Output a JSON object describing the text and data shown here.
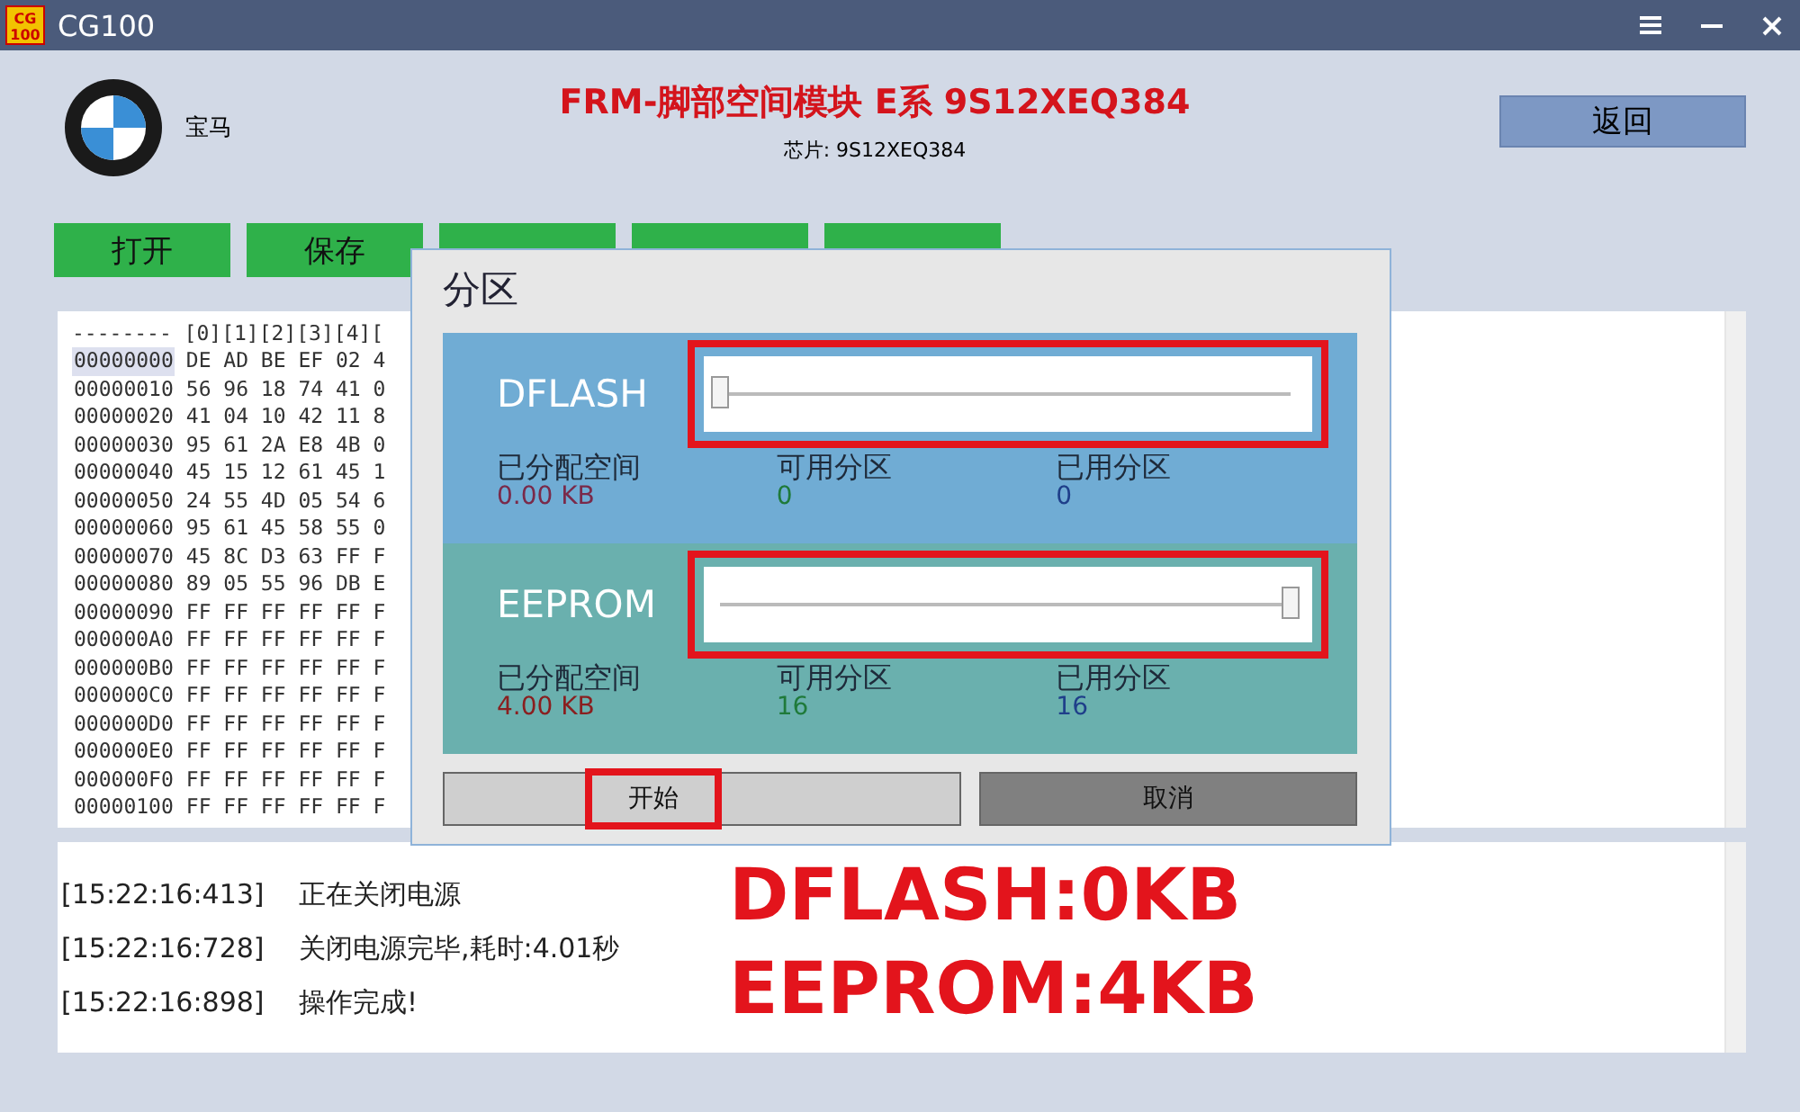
{
  "window": {
    "title": "CG100",
    "app_badge": "CG 100"
  },
  "header": {
    "brand": "宝马",
    "module_title": "FRM-脚部空间模块 E系 9S12XEQ384",
    "chip": "芯片: 9S12XEQ384",
    "back_button": "返回"
  },
  "toolbar": [
    {
      "kind": "labeled",
      "label": "打开"
    },
    {
      "kind": "labeled",
      "label": "保存"
    },
    {
      "kind": "covered"
    },
    {
      "kind": "covered"
    },
    {
      "kind": "covered"
    }
  ],
  "hex_view": {
    "header": "-------- [0][1][2][3][4][",
    "rows": [
      {
        "address": "00000000",
        "bytes": "DE AD BE EF 02 4",
        "selected": true
      },
      {
        "address": "00000010",
        "bytes": "56 96 18 74 41 0",
        "selected": false
      },
      {
        "address": "00000020",
        "bytes": "41 04 10 42 11 8",
        "selected": false
      },
      {
        "address": "00000030",
        "bytes": "95 61 2A E8 4B 0",
        "selected": false
      },
      {
        "address": "00000040",
        "bytes": "45 15 12 61 45 1",
        "selected": false
      },
      {
        "address": "00000050",
        "bytes": "24 55 4D 05 54 6",
        "selected": false
      },
      {
        "address": "00000060",
        "bytes": "95 61 45 58 55 0",
        "selected": false
      },
      {
        "address": "00000070",
        "bytes": "45 8C D3 63 FF F",
        "selected": false
      },
      {
        "address": "00000080",
        "bytes": "89 05 55 96 DB E",
        "selected": false
      },
      {
        "address": "00000090",
        "bytes": "FF FF FF FF FF F",
        "selected": false
      },
      {
        "address": "000000A0",
        "bytes": "FF FF FF FF FF F",
        "selected": false
      },
      {
        "address": "000000B0",
        "bytes": "FF FF FF FF FF F",
        "selected": false
      },
      {
        "address": "000000C0",
        "bytes": "FF FF FF FF FF F",
        "selected": false
      },
      {
        "address": "000000D0",
        "bytes": "FF FF FF FF FF F",
        "selected": false
      },
      {
        "address": "000000E0",
        "bytes": "FF FF FF FF FF F",
        "selected": false
      },
      {
        "address": "000000F0",
        "bytes": "FF FF FF FF FF F",
        "selected": false
      },
      {
        "address": "00000100",
        "bytes": "FF FF FF FF FF F",
        "selected": false
      }
    ]
  },
  "log": [
    {
      "time": "[15:22:16:413]",
      "message": "正在关闭电源"
    },
    {
      "time": "[15:22:16:728]",
      "message": "关闭电源完毕,耗时:4.01秒"
    },
    {
      "time": "[15:22:16:898]",
      "message": "操作完成!"
    }
  ],
  "annotation": [
    "DFLASH:0KB",
    "EEPROM:4KB"
  ],
  "dialog": {
    "title": "分区",
    "sections": [
      {
        "name": "DFLASH",
        "color": "#70acd4",
        "level": 0,
        "highlighted": true,
        "stats": [
          {
            "label": "已分配空间",
            "value": "0.00 KB",
            "color": "#7a2a4a"
          },
          {
            "label": "可用分区",
            "value": "0",
            "color": "#1f7a3a"
          },
          {
            "label": "已用分区",
            "value": "0",
            "color": "#1f3f8a"
          }
        ]
      },
      {
        "name": "EEPROM",
        "color": "#6ab0ae",
        "level": 1,
        "highlighted": true,
        "stats": [
          {
            "label": "已分配空间",
            "value": "4.00 KB",
            "color": "#8a1f1f"
          },
          {
            "label": "可用分区",
            "value": "16",
            "color": "#1f7a3a"
          },
          {
            "label": "已用分区",
            "value": "16",
            "color": "#1f3f8a"
          }
        ]
      }
    ],
    "buttons": [
      {
        "label": "开始",
        "highlighted": true,
        "kind": "light"
      },
      {
        "label": "取消",
        "highlighted": false,
        "kind": "dark"
      }
    ]
  }
}
